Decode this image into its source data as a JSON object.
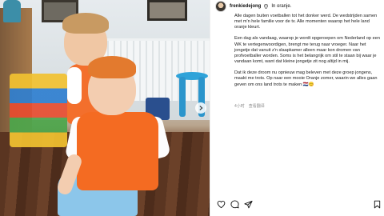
{
  "post": {
    "username": "frenkiedejong",
    "location": "In oranje.",
    "caption": [
      "Alle dagen buiten voetballen tot het donker werd. De wedstrijden samen met m'n hele familie voor de tv. Alle momenten waarop het hele land oranje kleurt.",
      "Een dag als vandaag, waarop je wordt opgeroepen om Nederland op een WK te vertegenwoordigen, brengt me terug naar vroeger. Naar het jongetje dat vanuit z'n slaapkamer alleen maar kon dromen van profvoetballer worden. Soms is het belangrijk om stil te staan bij waar je vandaan komt, want dat kleine jongetje zit nog altijd in mij.",
      "Dat ik deze droom nu opnieuw mag beleven met deze groep jongens, maakt me trots. Op naar een mooie Oranje zomer, waarin we alles gaan geven om ons land trots te maken 🇳🇱😊"
    ],
    "time_ago": "4小时",
    "translate_label": "查看翻译"
  },
  "icons": {
    "heart": "heart-icon",
    "comment": "comment-icon",
    "share": "share-icon",
    "bookmark": "bookmark-icon",
    "pin": "location-pin-icon",
    "next": "chevron-right-icon"
  },
  "colors": {
    "text": "#1a1a1a",
    "muted": "#8e8e8e",
    "orange": "#f46b22"
  }
}
